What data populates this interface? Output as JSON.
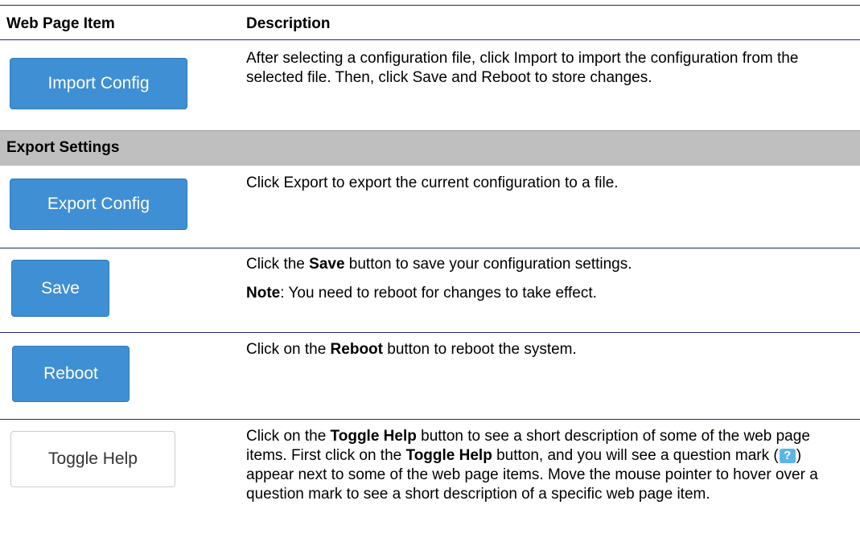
{
  "header": {
    "col1": "Web Page Item",
    "col2": "Description"
  },
  "rows": [
    {
      "button": "Import Config",
      "desc": "After selecting a configuration file, click Import to import the configuration from the selected file. Then, click Save and Reboot to store changes."
    },
    {
      "button": "Export Config",
      "desc": "Click Export to export the current configuration to a file."
    },
    {
      "button": "Save",
      "desc_pre": "Click the ",
      "desc_bold": "Save",
      "desc_post": " button to save your configuration settings.",
      "note_bold": "Note",
      "note_post": ": You need to reboot for changes to take effect."
    },
    {
      "button": "Reboot",
      "desc_pre": "Click on the ",
      "desc_bold": "Reboot",
      "desc_post": " button to reboot the system."
    },
    {
      "button": "Toggle Help",
      "p1": "Click on the ",
      "b1": "Toggle Help",
      "p2": " button to see a short description of some of the web page items. First click on the ",
      "b2": "Toggle Help",
      "p3": " button, and you will see a question mark (",
      "icon_glyph": "?",
      "p4": ") appear next to some of the web page items. Move the mouse pointer to hover over a question mark to see a short description of a specific web page item."
    }
  ],
  "section": {
    "export_settings": "Export Settings"
  },
  "colors": {
    "rule": "#1f2a7a",
    "band": "#bfbfbf",
    "button_blue": "#3f8fd4",
    "help_icon": "#5bb6e8"
  }
}
